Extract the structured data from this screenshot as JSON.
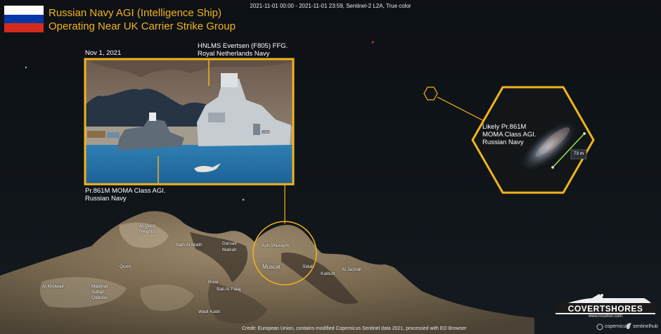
{
  "header": {
    "acquisition": "2021-11-01 00:00 - 2021-11-01 23:59, Sentinel-2 L2A, True color"
  },
  "title": {
    "line1": "Russian Navy AGI (Intelligence Ship)",
    "line2": "Operating Near UK Carrier Strike Group"
  },
  "flag": {
    "name": "russia-flag",
    "colors": [
      "#ffffff",
      "#0039a6",
      "#d52b1e"
    ]
  },
  "inset_photo": {
    "date": "Nov 1, 2021",
    "frigate_label_line1": "HNLMS Evertsen (F805) FFG.",
    "frigate_label_line2": "Royal Netherlands Navy",
    "agi_label_line1": "Pr.861M MOMA Class AGI.",
    "agi_label_line2": "Russian Navy"
  },
  "hex_callout": {
    "label_line1": "Likely Pr.861M",
    "label_line2": "MOMA Class AGI.",
    "label_line3": "Russian Navy",
    "measure": "73 m"
  },
  "map_places": [
    "Al Qurm Heights",
    "Saih Al Malih",
    "Darsait",
    "Matrah",
    "Ash Shuraym",
    "Muscat",
    "Sidab",
    "Al Jazirah",
    "Qurm",
    "Madinat Sultan Qaboos",
    "Ruwi",
    "Bait Al Falaj",
    "Kalbuh",
    "Wadi Kabir",
    "Al Khuwair"
  ],
  "credit": "Credit: European Union, contains modified Copernicus Sentinel data 2021, processed with EO Browser",
  "logos": {
    "brand_main": "COVERTSHORES",
    "brand_sub": "www.hisutton.com",
    "copernicus": "copernicus",
    "sentinelhub": "sentinelhub"
  },
  "colors": {
    "accent": "#f2b31c",
    "ruler": "#9be24a"
  }
}
